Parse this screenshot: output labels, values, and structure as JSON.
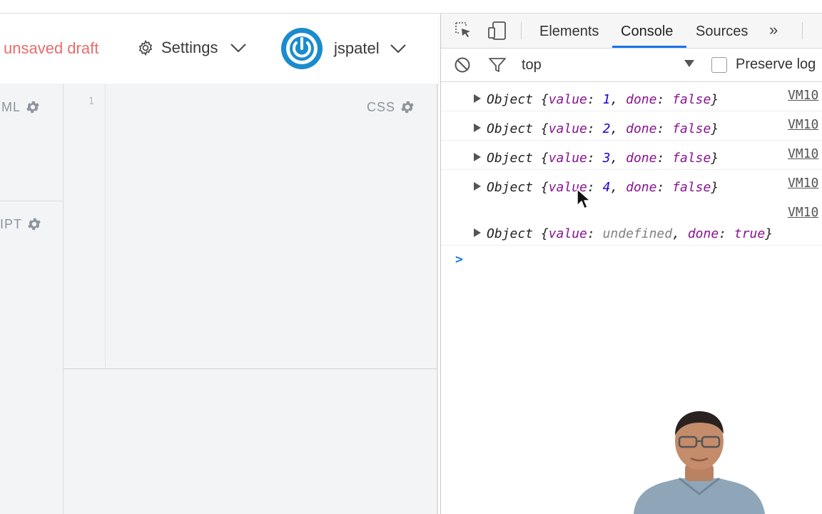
{
  "app": {
    "draft_status": "unsaved draft",
    "settings_label": "Settings",
    "username": "jspatel",
    "panels": {
      "html_label": "ML",
      "js_label": "IPT",
      "css_label": "CSS",
      "line_number": "1"
    }
  },
  "devtools": {
    "tabs": [
      "Elements",
      "Console",
      "Sources"
    ],
    "active_tab": "Console",
    "more_tabs": "»",
    "context": "top",
    "preserve_log_label": "Preserve log",
    "preserve_log_checked": false,
    "console_rows": [
      {
        "value": "1",
        "done": "false",
        "source": "VM10"
      },
      {
        "value": "2",
        "done": "false",
        "source": "VM10"
      },
      {
        "value": "3",
        "done": "false",
        "source": "VM10"
      },
      {
        "value": "4",
        "done": "false",
        "source": "VM10"
      },
      {
        "value": "undefined",
        "done": "true",
        "source": "VM10"
      }
    ],
    "obj_prefix": "Object {",
    "key_value": "value",
    "key_done": "done",
    "obj_suffix": "}",
    "prompt_symbol": ">"
  },
  "colors": {
    "draft": "#e86c6c",
    "avatar": "#1a8ccd",
    "tab_underline": "#1a73e8",
    "js_key": "#881391",
    "js_number": "#1c00cf"
  },
  "icons": [
    "gear-icon",
    "chevron-down-icon",
    "power-icon",
    "inspect-icon",
    "device-icon",
    "clear-console-icon",
    "filter-icon",
    "dropdown-caret-icon",
    "mouse-cursor-icon"
  ]
}
